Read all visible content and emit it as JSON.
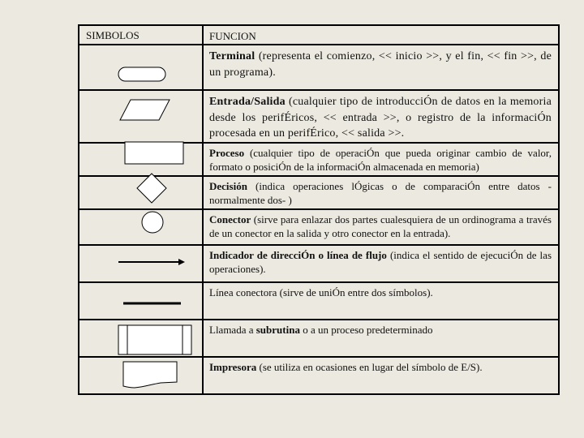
{
  "table": {
    "headers": {
      "symbols": "SIMBOLOS",
      "function": "FUNCION"
    },
    "rows": [
      {
        "symbol": "terminal-oval",
        "term": "Terminal",
        "text": " (representa el comienzo, << inicio >>, y el fin, << fin >>, de un programa).",
        "prefix": ""
      },
      {
        "symbol": "input-output-parallelogram",
        "term": "Entrada/Salida",
        "text": " (cualquier tipo de introducciÓn de datos en la memoria desde los perifÉricos, << entrada >>, o registro de la informaciÓn procesada en un  perifÉrico, << salida >>.",
        "prefix": ""
      },
      {
        "symbol": "process-rectangle",
        "term": "Proceso",
        "text": " (cualquier tipo de operaciÓn que pueda originar cambio de valor, formato o posiciÓn de la informaciÓn almacenada en memoria)",
        "prefix": ""
      },
      {
        "symbol": "decision-diamond",
        "term": "Decisión",
        "text": " (indica operaciones lÓgicas o de comparaciÓn entre datos -normalmente dos- )",
        "prefix": ""
      },
      {
        "symbol": "connector-circle",
        "term": "Conector",
        "text": " (sirve para enlazar dos partes cualesquiera de un ordinograma a través de un conector en la salida y otro conector en la entrada).",
        "prefix": ""
      },
      {
        "symbol": "flow-arrow",
        "term": "Indicador de direcciÓn o línea de flujo",
        "text": " (indica el sentido de ejecuciÓn de las operaciones).",
        "prefix": ""
      },
      {
        "symbol": "connector-line",
        "term": "",
        "text": "Línea conectora (sirve de uniÓn entre dos símbolos).",
        "prefix": ""
      },
      {
        "symbol": "subroutine-box",
        "term": "subrutina",
        "text": " o a un proceso predeterminado",
        "prefix": "Llamada a "
      },
      {
        "symbol": "printer-document",
        "term": "Impresora",
        "text": " (se utiliza en ocasiones en lugar del símbolo de E/S).",
        "prefix": ""
      }
    ]
  }
}
